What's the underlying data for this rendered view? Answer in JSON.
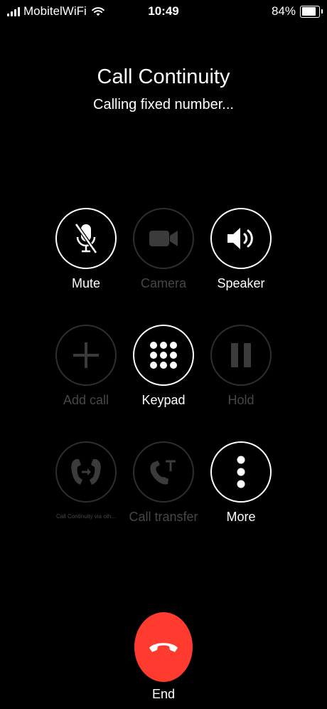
{
  "status_bar": {
    "carrier": "MobitelWiFi",
    "time": "10:49",
    "battery": "84%",
    "battery_level": 0.84,
    "signal_bars": 4
  },
  "call": {
    "title": "Call Continuity",
    "status": "Calling fixed number..."
  },
  "controls": {
    "mute": {
      "label": "Mute",
      "icon": "mic-off-icon",
      "enabled": true
    },
    "camera": {
      "label": "Camera",
      "icon": "video-camera-icon",
      "enabled": false
    },
    "speaker": {
      "label": "Speaker",
      "icon": "speaker-icon",
      "enabled": true
    },
    "add_call": {
      "label": "Add call",
      "icon": "plus-icon",
      "enabled": false
    },
    "keypad": {
      "label": "Keypad",
      "icon": "keypad-icon",
      "enabled": true
    },
    "hold": {
      "label": "Hold",
      "icon": "pause-icon",
      "enabled": false
    },
    "continuity": {
      "label": "Call Continuity via oth...",
      "icon": "call-handoff-icon",
      "enabled": false
    },
    "transfer": {
      "label": "Call transfer",
      "icon": "call-transfer-icon",
      "enabled": false
    },
    "more": {
      "label": "More",
      "icon": "more-vertical-icon",
      "enabled": true
    }
  },
  "end": {
    "label": "End",
    "icon": "hang-up-icon",
    "color": "#ff3b30"
  },
  "colors": {
    "background": "#000000",
    "active": "#ffffff",
    "disabled": "#474747",
    "disabled_ring": "#2e2e2e",
    "end_button": "#ff3b30"
  }
}
